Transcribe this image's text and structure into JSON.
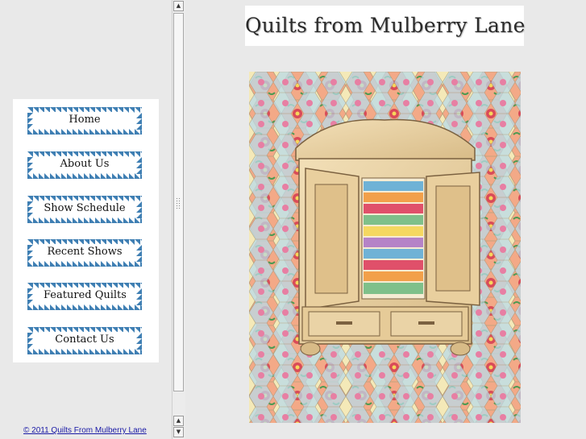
{
  "site": {
    "title": "Quilts from Mulberry Lane",
    "copyright": "© 2011 Quilts From Mulberry Lane"
  },
  "nav": {
    "items": [
      {
        "label": "Home"
      },
      {
        "label": "About Us"
      },
      {
        "label": "Show Schedule"
      },
      {
        "label": "Recent Shows"
      },
      {
        "label": "Featured Quilts"
      },
      {
        "label": "Contact Us"
      }
    ]
  },
  "colors": {
    "nav_border": "#3f7fb3",
    "link": "#1a1aa6"
  },
  "icons": {
    "scroll_up": "arrow-up-icon",
    "scroll_down": "arrow-down-icon"
  }
}
